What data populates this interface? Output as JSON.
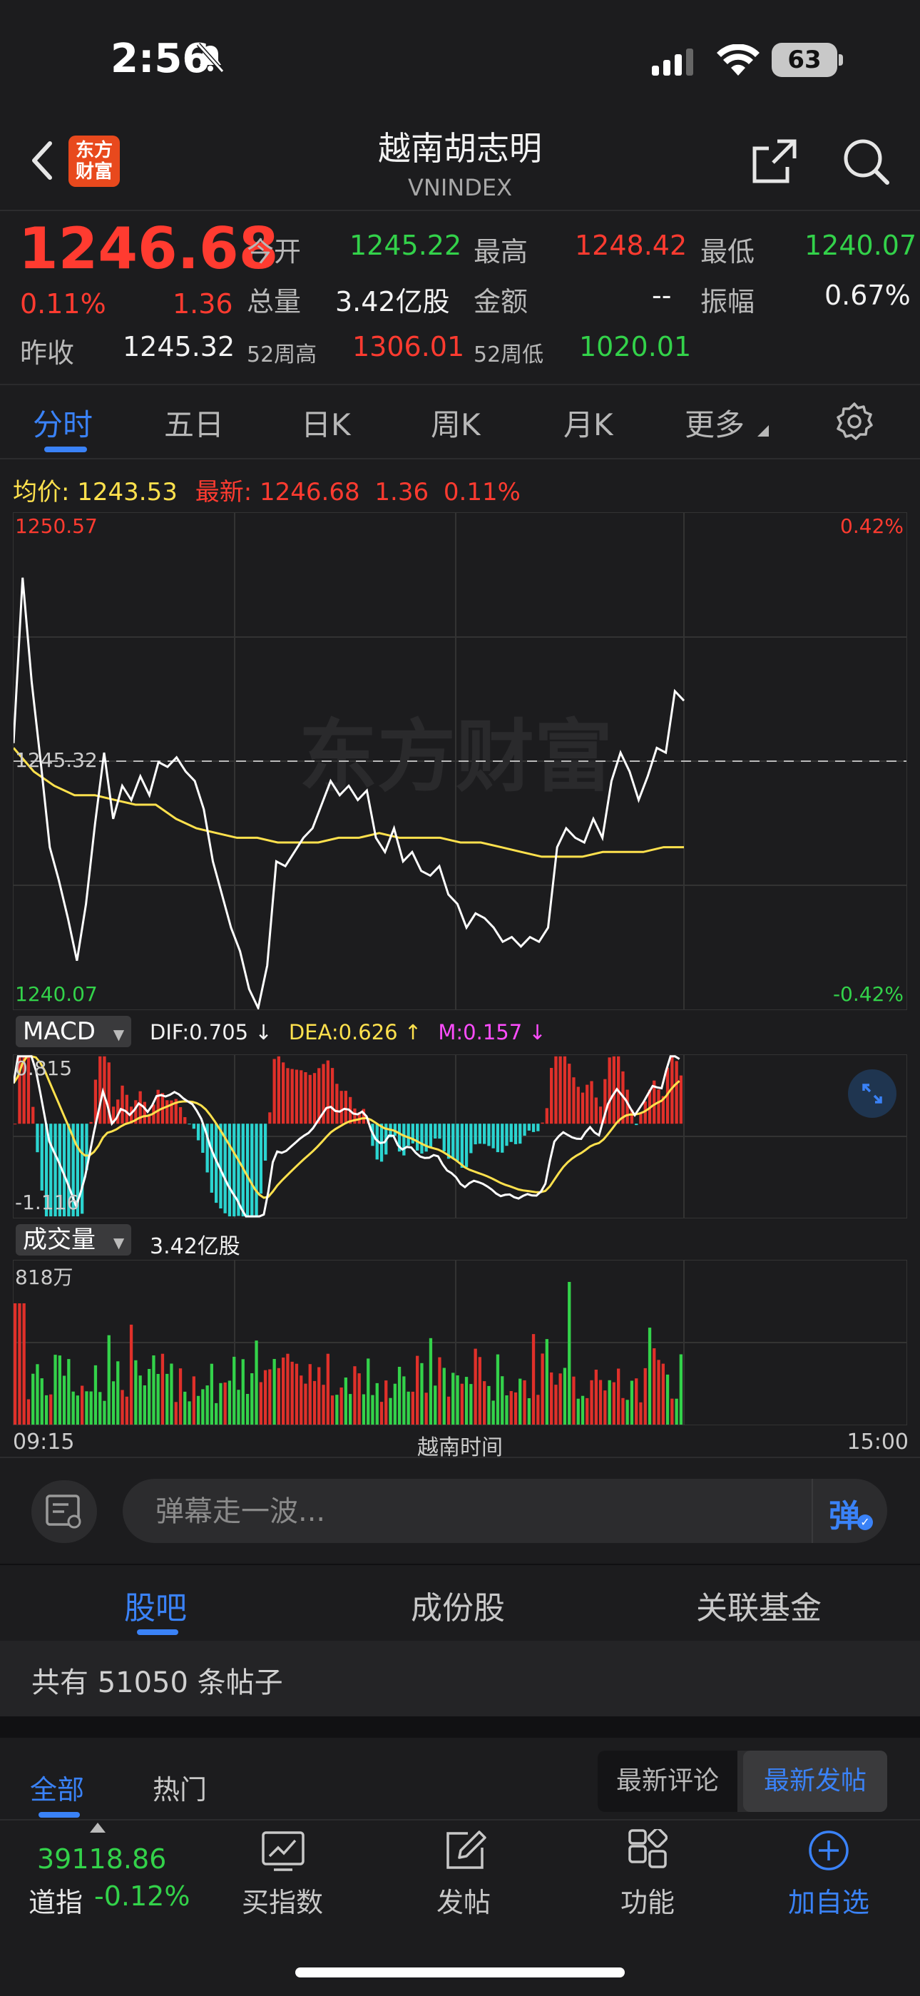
{
  "status_bar": {
    "time": "2:56",
    "battery": "63"
  },
  "header": {
    "logo_text": "东方\n财富",
    "title": "越南胡志明",
    "subtitle": "VNINDEX"
  },
  "quote": {
    "last": "1246.68",
    "change_pct": "0.11%",
    "change": "1.36",
    "open_label": "今开",
    "open": "1245.22",
    "high_label": "最高",
    "high": "1248.42",
    "low_label": "最低",
    "low": "1240.07",
    "volume_label": "总量",
    "volume": "3.42亿股",
    "amount_label": "金额",
    "amount": "--",
    "amplitude_label": "振幅",
    "amplitude": "0.67%",
    "prev_close_label": "昨收",
    "prev_close": "1245.32",
    "w52_high_label": "52周高",
    "w52_high": "1306.01",
    "w52_low_label": "52周低",
    "w52_low": "1020.01"
  },
  "chart_tabs": [
    "分时",
    "五日",
    "日K",
    "周K",
    "月K",
    "更多"
  ],
  "intraday": {
    "avg_label": "均价:",
    "avg_value": "1243.53",
    "latest_label": "最新:",
    "latest_value": "1246.68",
    "latest_change": "1.36",
    "latest_pct": "0.11%",
    "y_top": "1250.57",
    "y_bottom": "1240.07",
    "y_ref": "1245.32",
    "pct_top": "0.42%",
    "pct_bottom": "-0.42%",
    "watermark": "东方财富"
  },
  "macd": {
    "label": "MACD",
    "dif": "DIF:0.705 ↓",
    "dea": "DEA:0.626 ↑",
    "m": "M:0.157 ↓",
    "y_top": "0.815",
    "y_bottom": "-1.116"
  },
  "volume_panel": {
    "label": "成交量",
    "total": "3.42亿股",
    "y_top": "818万",
    "x_start": "09:15",
    "x_mid": "越南时间",
    "x_end": "15:00"
  },
  "danmu": {
    "placeholder": "弹幕走一波...",
    "button": "弹"
  },
  "bottom_tabs": [
    "股吧",
    "成份股",
    "关联基金"
  ],
  "posts": {
    "count_text": "共有 51050 条帖子"
  },
  "sub_tabs": [
    "全部",
    "热门"
  ],
  "sort_options": [
    "最新评论",
    "最新发帖"
  ],
  "tabbar": {
    "index_value": "39118.86",
    "index_name": "道指",
    "index_change": "-0.12%",
    "items": [
      "买指数",
      "发帖",
      "功能",
      "加自选"
    ]
  },
  "colors": {
    "up": "#ff3b30",
    "down": "#33d24a",
    "accent": "#3a82f7",
    "avg": "#ffe14d",
    "macd_m": "#ff4dff"
  },
  "chart_data": {
    "type": "line",
    "x_range": [
      "09:15",
      "15:00"
    ],
    "ylim": [
      1240.07,
      1250.57
    ],
    "reference": 1245.32,
    "series": [
      {
        "values": [
          1245.7,
          1249.2,
          1247.0,
          1245.3,
          1243.5,
          1242.8,
          1242.0,
          1241.1,
          1242.3,
          1244.0,
          1245.5,
          1244.1,
          1244.8,
          1244.5,
          1245.0,
          1244.6,
          1245.3,
          1245.2,
          1245.4,
          1245.1,
          1244.9,
          1244.3,
          1243.2,
          1242.5,
          1241.8,
          1241.3,
          1240.5,
          1240.1,
          1241.0,
          1243.2,
          1243.1,
          1243.4,
          1243.7,
          1243.9,
          1244.4,
          1244.9,
          1244.6,
          1244.8,
          1244.5,
          1244.7,
          1243.7,
          1243.4,
          1243.9,
          1243.2,
          1243.4,
          1243.0,
          1242.9,
          1243.1,
          1242.5,
          1242.3,
          1241.8,
          1242.1,
          1242.0,
          1241.8,
          1241.5,
          1241.6,
          1241.4,
          1241.6,
          1241.5,
          1241.8,
          1243.5,
          1243.9,
          1243.7,
          1243.6,
          1244.1,
          1243.7,
          1244.9,
          1245.5,
          1245.1,
          1244.5,
          1245.0,
          1245.6,
          1245.5,
          1246.8,
          1246.6
        ],
        "step": 1
      },
      {
        "values": [
          1245.6,
          1245.1,
          1244.8,
          1244.6,
          1244.6,
          1244.5,
          1244.4,
          1244.4,
          1244.1,
          1243.9,
          1243.8,
          1243.7,
          1243.7,
          1243.6,
          1243.6,
          1243.6,
          1243.7,
          1243.7,
          1243.8,
          1243.7,
          1243.7,
          1243.7,
          1243.6,
          1243.6,
          1243.5,
          1243.4,
          1243.3,
          1243.3,
          1243.3,
          1243.4,
          1243.4,
          1243.4,
          1243.5,
          1243.5
        ],
        "step": 2.25
      }
    ]
  }
}
